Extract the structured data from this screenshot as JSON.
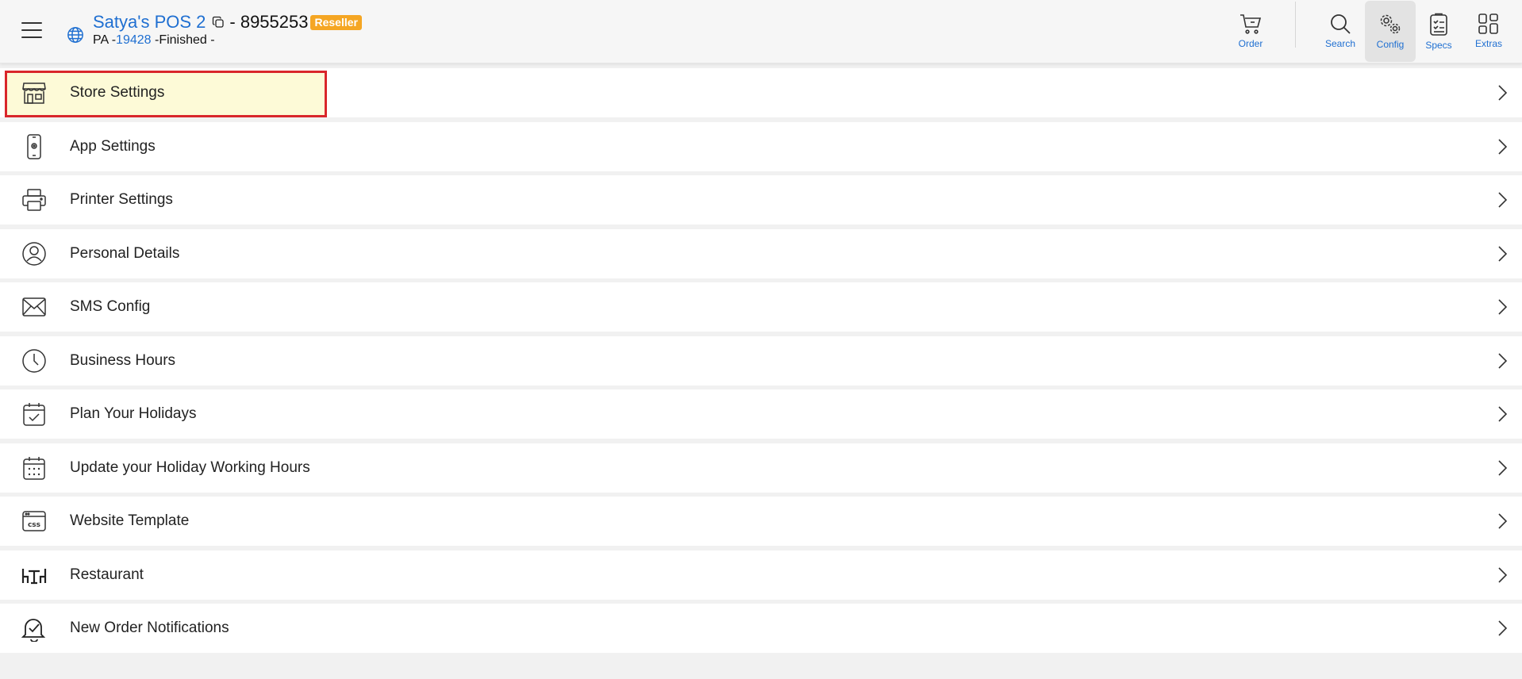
{
  "header": {
    "store_name": "Satya's POS 2",
    "store_id": "- 8955253",
    "badge": "Reseller",
    "sub_prefix": "PA -",
    "sub_link": "19428",
    "sub_suffix": " -Finished -"
  },
  "nav": {
    "order": "Order",
    "search": "Search",
    "config": "Config",
    "specs": "Specs",
    "extras": "Extras"
  },
  "menu": [
    {
      "label": "Store Settings",
      "icon": "store-icon"
    },
    {
      "label": "App Settings",
      "icon": "phone-icon"
    },
    {
      "label": "Printer Settings",
      "icon": "printer-icon"
    },
    {
      "label": "Personal Details",
      "icon": "user-circle-icon"
    },
    {
      "label": "SMS Config",
      "icon": "envelope-icon"
    },
    {
      "label": "Business Hours",
      "icon": "clock-icon"
    },
    {
      "label": "Plan Your Holidays",
      "icon": "calendar-check-icon"
    },
    {
      "label": "Update your Holiday Working Hours",
      "icon": "calendar-grid-icon"
    },
    {
      "label": "Website Template",
      "icon": "css-icon"
    },
    {
      "label": "Restaurant",
      "icon": "table-chairs-icon"
    },
    {
      "label": "New Order Notifications",
      "icon": "bell-check-icon"
    }
  ],
  "colors": {
    "link": "#1f6fd1",
    "badge": "#f5a623",
    "highlight_fill": "#fdfad7",
    "highlight_border": "#d9262b"
  }
}
